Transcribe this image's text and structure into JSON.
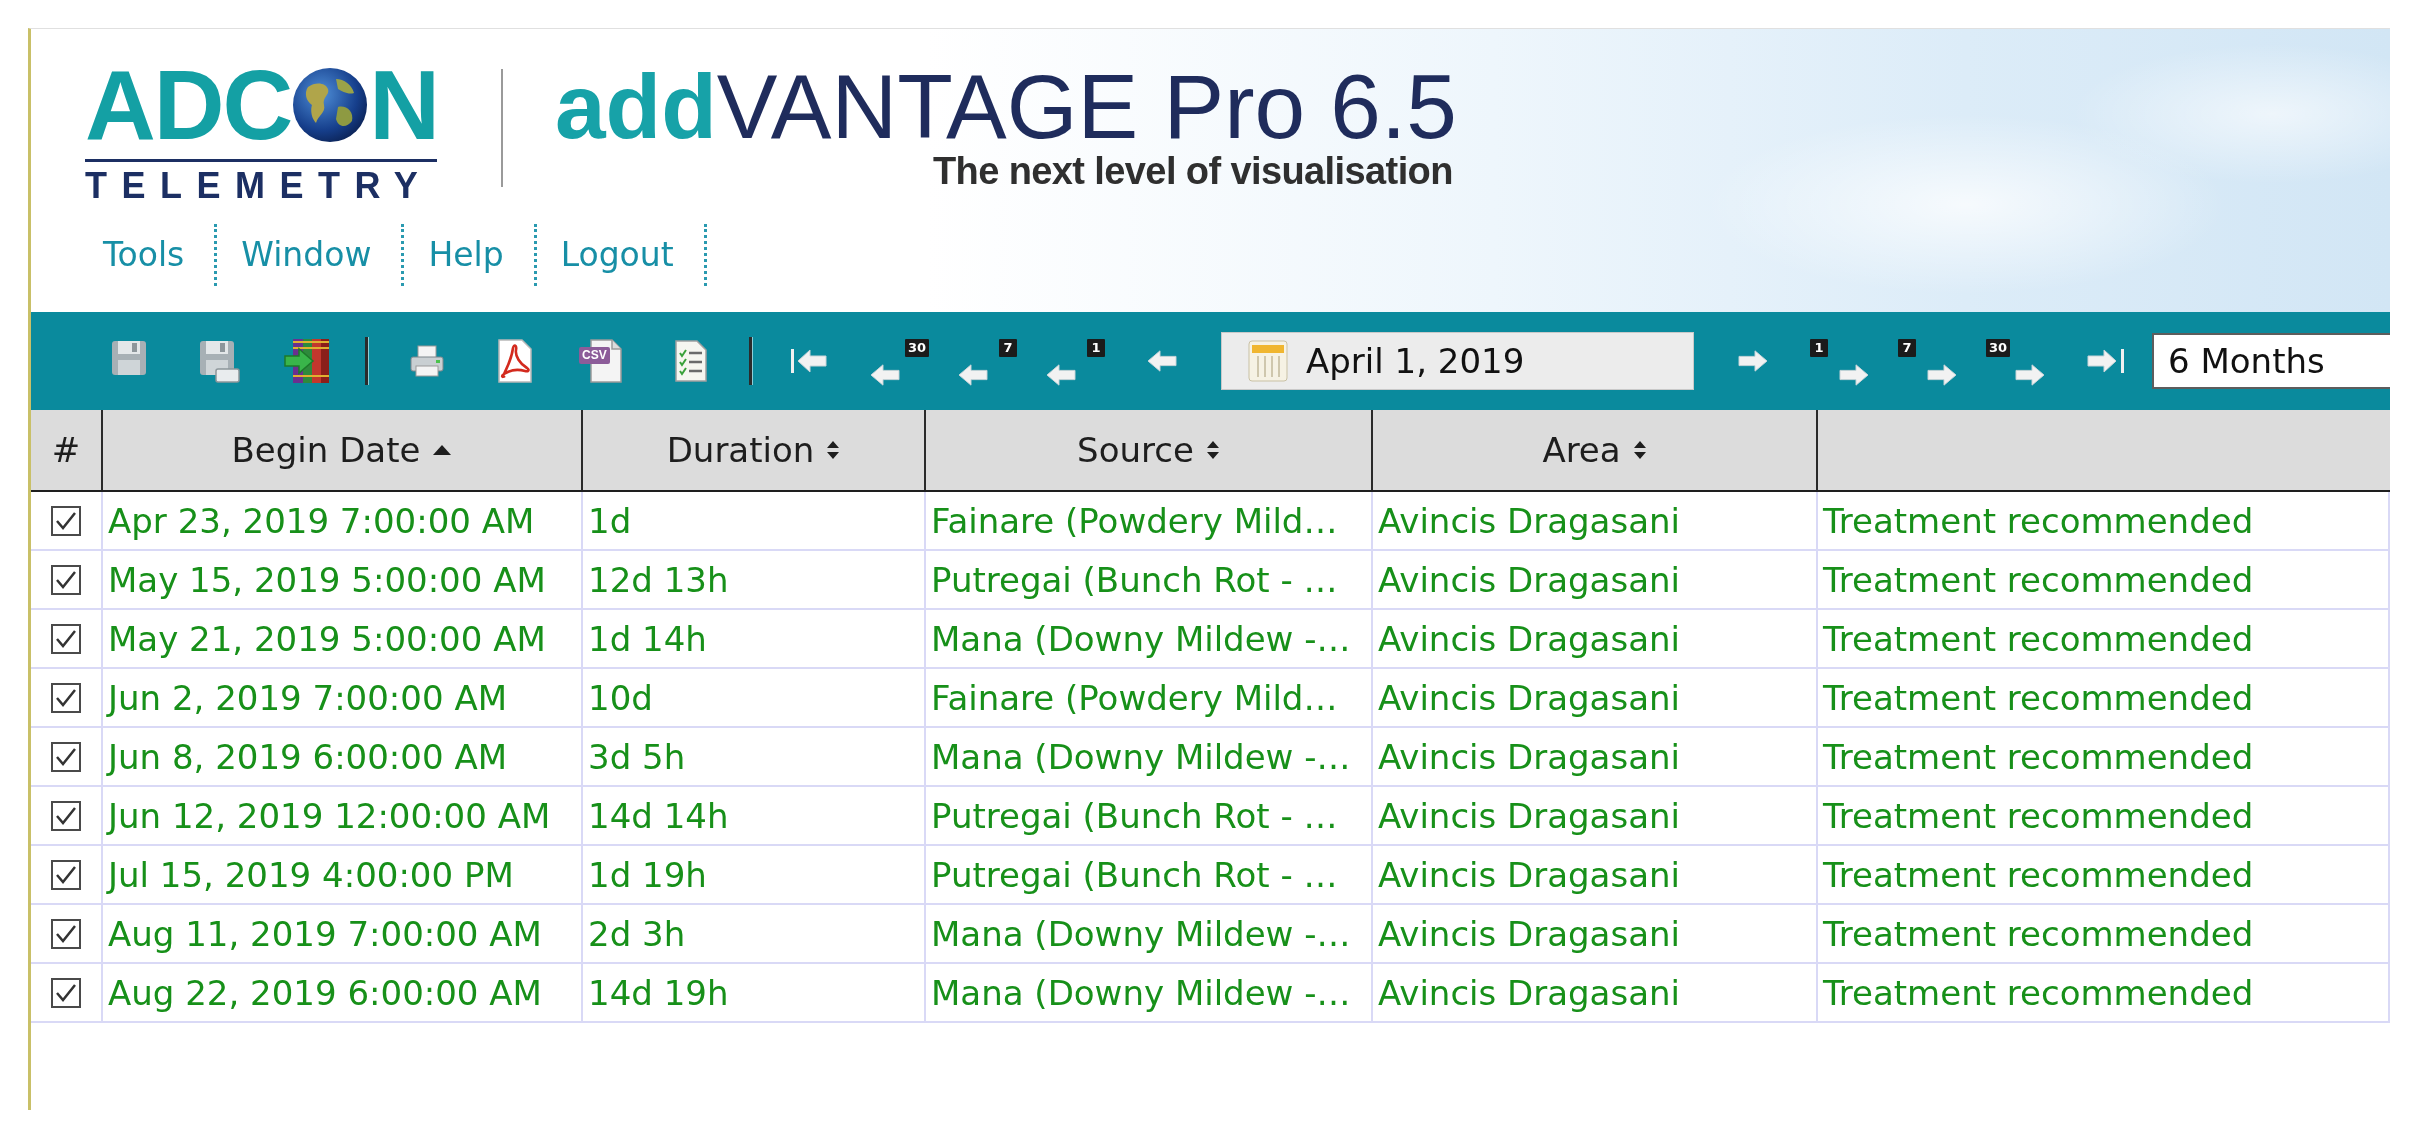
{
  "logo": {
    "wordmark_start": "ADC",
    "wordmark_end": "N",
    "subtitle": "TELEMETRY"
  },
  "product": {
    "accent": "add",
    "name": "VANTAGE Pro 6.5",
    "tagline": "The next level of visualisation"
  },
  "menu": [
    "Tools",
    "Window",
    "Help",
    "Logout"
  ],
  "toolbar": {
    "items": [
      {
        "kind": "save"
      },
      {
        "kind": "save_as"
      },
      {
        "kind": "import"
      },
      {
        "kind": "separator"
      },
      {
        "kind": "print"
      },
      {
        "kind": "pdf"
      },
      {
        "kind": "csv",
        "label": "CSV"
      },
      {
        "kind": "report"
      },
      {
        "kind": "separator"
      },
      {
        "kind": "first"
      },
      {
        "kind": "back",
        "badge": "30"
      },
      {
        "kind": "back",
        "badge": "7"
      },
      {
        "kind": "back",
        "badge": "1"
      },
      {
        "kind": "back"
      },
      {
        "kind": "date",
        "value": "April 1, 2019"
      },
      {
        "kind": "forward"
      },
      {
        "kind": "forward",
        "badge": "1"
      },
      {
        "kind": "forward",
        "badge": "7"
      },
      {
        "kind": "forward",
        "badge": "30"
      },
      {
        "kind": "last"
      },
      {
        "kind": "select",
        "value": "6 Months"
      }
    ]
  },
  "table": {
    "columns": [
      {
        "label": "#"
      },
      {
        "label": "Begin Date",
        "sortable": true,
        "sorted": true
      },
      {
        "label": "Duration",
        "sortable": true,
        "sorted": false
      },
      {
        "label": "Source",
        "sortable": true,
        "sorted": false
      },
      {
        "label": "Area",
        "sortable": true,
        "sorted": false
      }
    ],
    "rows": [
      {
        "checked": true,
        "begin_date": "Apr 23, 2019 7:00:00 AM",
        "duration": "1d",
        "source": "Fainare (Powdery Mild…",
        "area": "Avincis Dragasani",
        "column_6": "Treatment recommended"
      },
      {
        "checked": true,
        "begin_date": "May 15, 2019 5:00:00 AM",
        "duration": "12d 13h",
        "source": "Putregai (Bunch Rot - …",
        "area": "Avincis Dragasani",
        "column_6": "Treatment recommended"
      },
      {
        "checked": true,
        "begin_date": "May 21, 2019 5:00:00 AM",
        "duration": "1d 14h",
        "source": "Mana (Downy Mildew -…",
        "area": "Avincis Dragasani",
        "column_6": "Treatment recommended"
      },
      {
        "checked": true,
        "begin_date": "Jun 2, 2019 7:00:00 AM",
        "duration": "10d",
        "source": "Fainare (Powdery Mild…",
        "area": "Avincis Dragasani",
        "column_6": "Treatment recommended"
      },
      {
        "checked": true,
        "begin_date": "Jun 8, 2019 6:00:00 AM",
        "duration": "3d 5h",
        "source": "Mana (Downy Mildew -…",
        "area": "Avincis Dragasani",
        "column_6": "Treatment recommended"
      },
      {
        "checked": true,
        "begin_date": "Jun 12, 2019 12:00:00 AM",
        "duration": "14d 14h",
        "source": "Putregai (Bunch Rot - …",
        "area": "Avincis Dragasani",
        "column_6": "Treatment recommended"
      },
      {
        "checked": true,
        "begin_date": "Jul 15, 2019 4:00:00 PM",
        "duration": "1d 19h",
        "source": "Putregai (Bunch Rot - …",
        "area": "Avincis Dragasani",
        "column_6": "Treatment recommended"
      },
      {
        "checked": true,
        "begin_date": "Aug 11, 2019 7:00:00 AM",
        "duration": "2d 3h",
        "source": "Mana (Downy Mildew -…",
        "area": "Avincis Dragasani",
        "column_6": "Treatment recommended"
      },
      {
        "checked": true,
        "begin_date": "Aug 22, 2019 6:00:00 AM",
        "duration": "14d 19h",
        "source": "Mana (Downy Mildew -…",
        "area": "Avincis Dragasani",
        "column_6": "Treatment recommended"
      }
    ]
  }
}
